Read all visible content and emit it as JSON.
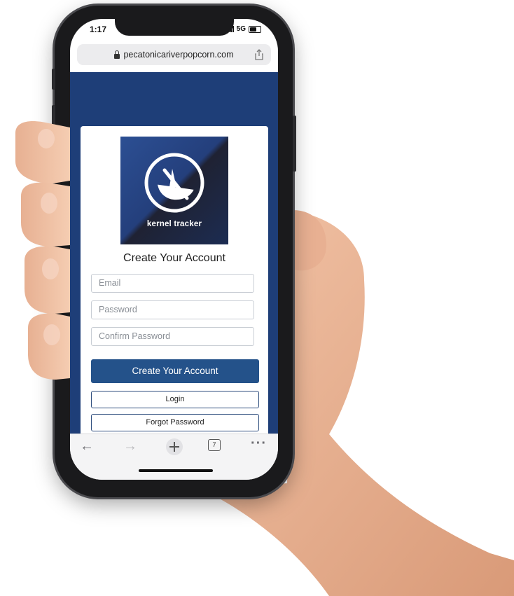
{
  "status_bar": {
    "time": "1:17",
    "network": "5G"
  },
  "browser": {
    "url": "pecatonicariverpopcorn.com",
    "tab_count": "7",
    "nav_icons": [
      "back-arrow-icon",
      "forward-arrow-icon",
      "plus-icon",
      "tabs-icon",
      "more-icon"
    ]
  },
  "logo": {
    "text": "kernel tracker"
  },
  "form": {
    "title": "Create Your Account",
    "email_placeholder": "Email",
    "password_placeholder": "Password",
    "confirm_placeholder": "Confirm Password",
    "submit_label": "Create Your Account",
    "login_label": "Login",
    "forgot_label": "Forgot Password"
  },
  "colors": {
    "page_background": "#1e3e78",
    "primary_button": "#24528a",
    "card": "#ffffff"
  }
}
